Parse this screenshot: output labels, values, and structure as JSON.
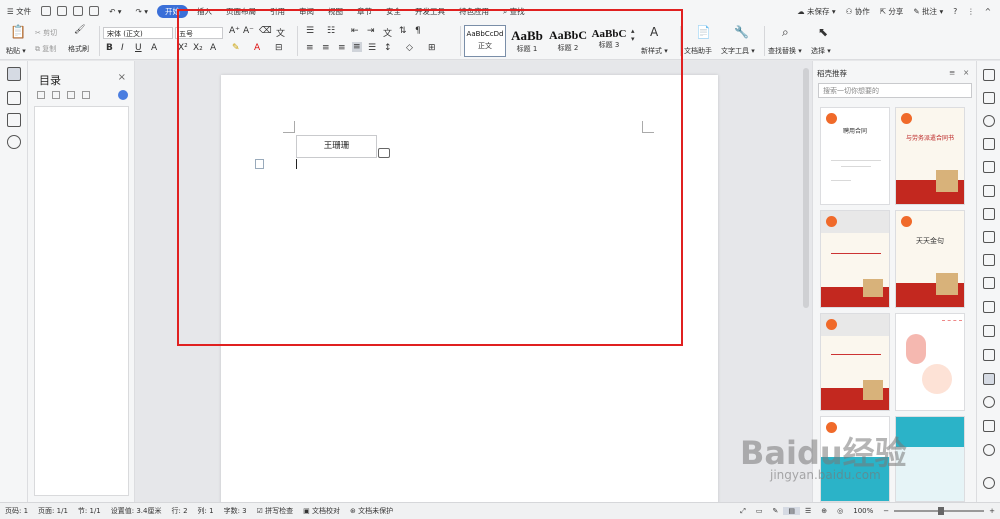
{
  "menu": {
    "file": "文件",
    "tabs": [
      "开始",
      "插入",
      "页面布局",
      "引用",
      "审阅",
      "视图",
      "章节",
      "安全",
      "开发工具",
      "特色应用"
    ],
    "search": "查找",
    "right": [
      "未保存",
      "协作",
      "分享",
      "批注"
    ]
  },
  "ribbon": {
    "paste": "粘贴",
    "cut": "剪切",
    "copy": "复制",
    "format_painter": "格式刷",
    "font_name": "宋体 (正文)",
    "font_size": "五号",
    "styles": [
      {
        "preview": "AaBbCcDd",
        "label": "正文"
      },
      {
        "preview": "AaBb",
        "label": "标题 1"
      },
      {
        "preview": "AaBbC",
        "label": "标题 2"
      },
      {
        "preview": "AaBbC",
        "label": "标题 3"
      }
    ],
    "new_style": "新样式",
    "doc_assistant": "文档助手",
    "text_tools": "文字工具",
    "find_replace": "查找替换",
    "select": "选择"
  },
  "toc": {
    "title": "目录",
    "close": "×"
  },
  "document": {
    "name_text": "王珊珊"
  },
  "right_panel": {
    "title": "稻壳推荐",
    "search_placeholder": "搜索一切你想要的",
    "cards": [
      {
        "title": "聘用合同"
      },
      {
        "title": "与劳务派遣合同书"
      },
      {
        "title": ""
      },
      {
        "title": "天天金句"
      },
      {
        "title": ""
      },
      {
        "title": ""
      }
    ]
  },
  "status": {
    "page_no": "页码: 1",
    "pages": "页面: 1/1",
    "section": "节: 1/1",
    "setting": "设置值: 3.4厘米",
    "row": "行: 2",
    "col": "列: 1",
    "words": "字数: 3",
    "spell": "拼写检查",
    "proof": "文档校对",
    "protect": "文档未保护",
    "zoom": "100%"
  },
  "watermark": {
    "brand": "Baidu经验",
    "url": "jingyan.baidu.com"
  },
  "colors": {
    "accent": "#3a6fd8",
    "highlight_box": "#e02020",
    "badge": "#f06a2a"
  }
}
